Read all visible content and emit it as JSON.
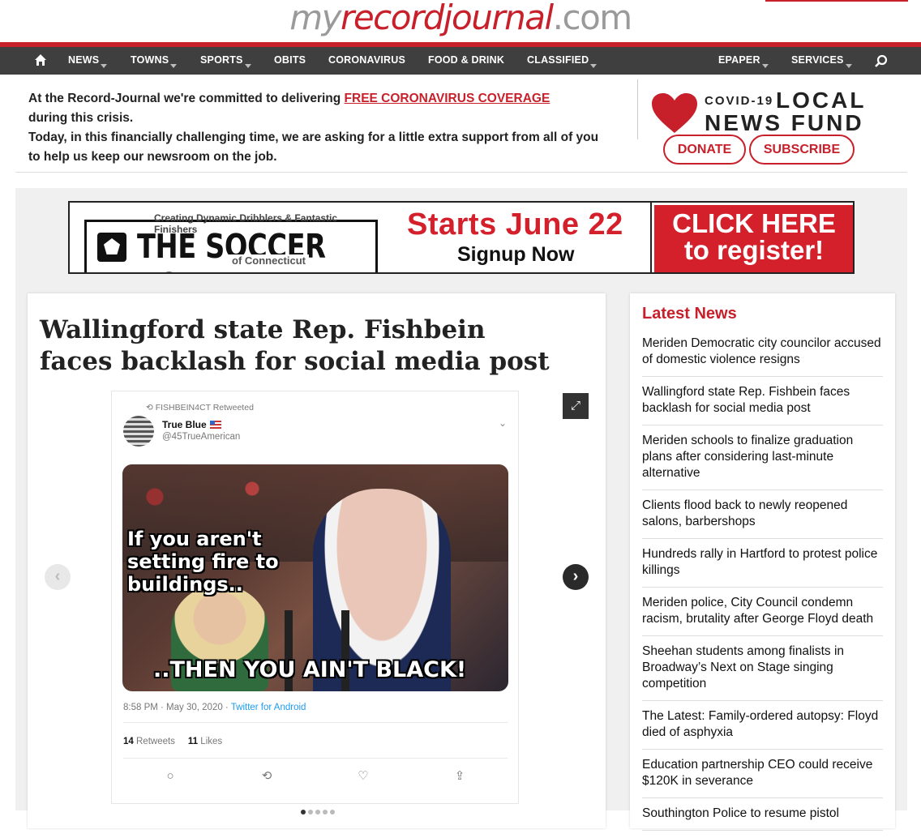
{
  "site": {
    "logo_my": "my",
    "logo_name": "recordjournal",
    "logo_tld": ".com"
  },
  "nav": {
    "items": [
      {
        "label": "NEWS",
        "dropdown": true
      },
      {
        "label": "TOWNS",
        "dropdown": true
      },
      {
        "label": "SPORTS",
        "dropdown": true
      },
      {
        "label": "OBITS",
        "dropdown": false
      },
      {
        "label": "CORONAVIRUS",
        "dropdown": false
      },
      {
        "label": "FOOD & DRINK",
        "dropdown": false
      },
      {
        "label": "CLASSIFIED",
        "dropdown": true
      },
      {
        "label": "EPAPER",
        "dropdown": true
      },
      {
        "label": "SERVICES",
        "dropdown": true
      }
    ]
  },
  "promo": {
    "line1_start": "At the Record-Journal we're committed to delivering ",
    "link": "FREE CORONAVIRUS COVERAGE",
    "line1_end": "during this crisis.",
    "line2": "Today, in this financially challenging time, we are asking for a little extra support from all of you to help us keep our newsroom on the job.",
    "fund_covid": "COVID-19",
    "fund_local": "LOCAL",
    "fund_news": "NEWS FUND",
    "donate": "DONATE",
    "subscribe": "SUBSCRIBE"
  },
  "ad": {
    "tagline": "Creating Dynamic Dribblers & Fantastic Finishers",
    "brand": "THE SOCCER BOX",
    "region": "of Connecticut",
    "starts": "Starts June 22",
    "signup": "Signup Now",
    "cta_line1": "CLICK HERE",
    "cta_line2": "to register!"
  },
  "article": {
    "headline": "Wallingford state Rep. Fishbein faces backlash for social media post",
    "tweet": {
      "retweeted_by": "FISHBEIN4CT Retweeted",
      "name": "True Blue",
      "handle": "@45TrueAmerican",
      "caption_top": "If you aren't setting fire to buildings..",
      "caption_bottom": "..THEN YOU AIN'T BLACK!",
      "timestamp": "8:58 PM · May 30, 2020 · ",
      "source": "Twitter for Android",
      "retweets_count": "14",
      "retweets_label": "Retweets",
      "likes_count": "11",
      "likes_label": "Likes"
    },
    "gallery_slides": 5,
    "gallery_active": 1
  },
  "latest": {
    "title": "Latest News",
    "items": [
      "Meriden Democratic city councilor accused of domestic violence resigns",
      "Wallingford state Rep. Fishbein faces backlash for social media post",
      "Meriden schools to finalize graduation plans after considering last-minute alternative",
      "Clients flood back to newly reopened salons, barbershops",
      "Hundreds rally in Hartford to protest police killings",
      "Meriden police, City Council condemn racism, brutality after George Floyd death",
      "Sheehan students among finalists in Broadway’s Next on Stage singing competition",
      "The Latest: Family-ordered autopsy: Floyd died of asphyxia",
      "Education partnership CEO could receive $120K in severance",
      "Southington Police to resume pistol"
    ]
  },
  "colors": {
    "brand_red": "#c8202b",
    "nav_bg": "#3f3f3f",
    "page_gray": "#f0f0f0"
  },
  "icons": [
    "home-icon",
    "search-icon",
    "heart-icon",
    "expand-icon",
    "chevron-left-icon",
    "chevron-right-icon",
    "retweet-icon",
    "reply-icon",
    "like-icon",
    "share-icon"
  ]
}
